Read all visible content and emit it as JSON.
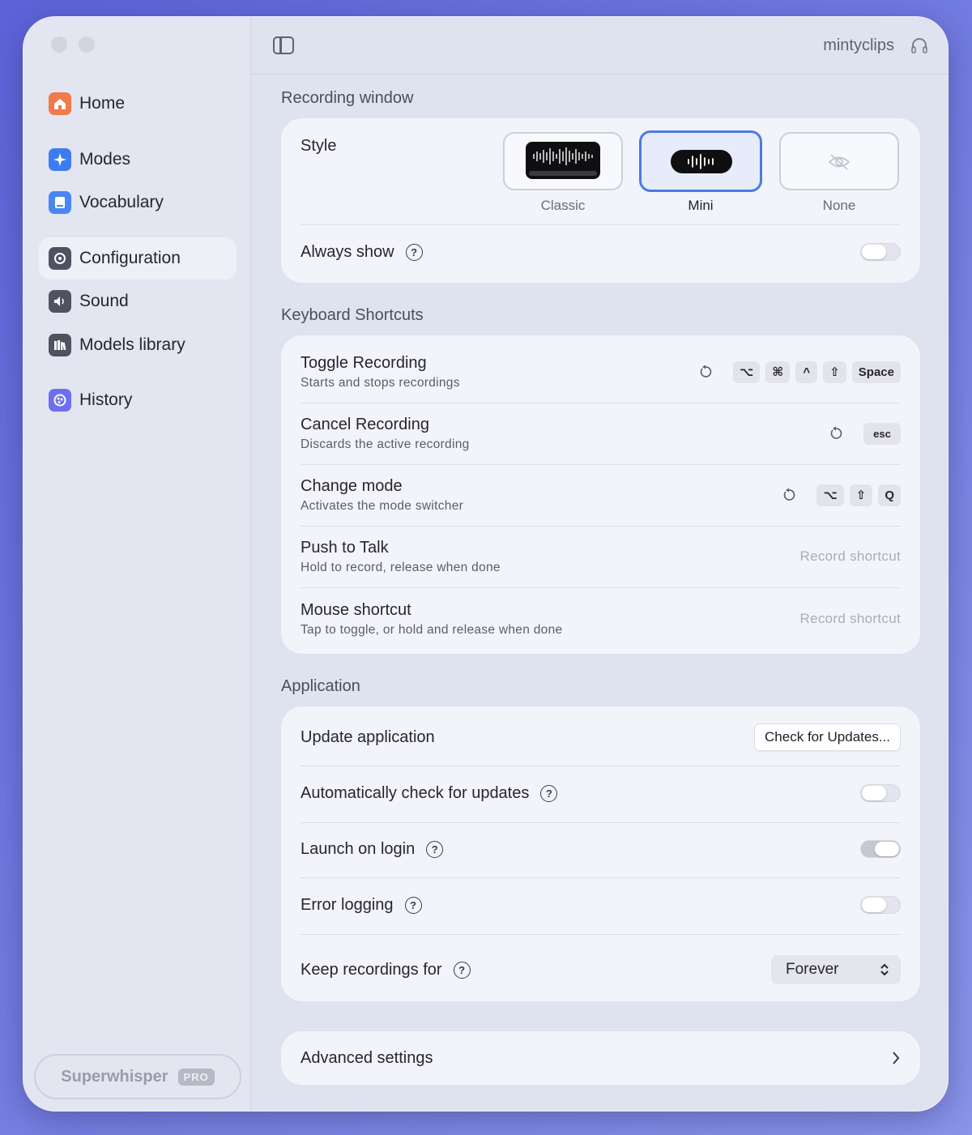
{
  "sidebar": {
    "items": [
      {
        "label": "Home",
        "icon": "home-icon",
        "color": "#f07a4a"
      },
      {
        "label": "Modes",
        "icon": "sparkle-icon",
        "color": "#3d7cf0"
      },
      {
        "label": "Vocabulary",
        "icon": "book-icon",
        "color": "#4a86ef"
      },
      {
        "label": "Configuration",
        "icon": "gear-icon",
        "color": "#4f5260"
      },
      {
        "label": "Sound",
        "icon": "speaker-icon",
        "color": "#4f5260"
      },
      {
        "label": "Models library",
        "icon": "library-icon",
        "color": "#4f5260"
      },
      {
        "label": "History",
        "icon": "history-icon",
        "color": "#6d6ff0"
      }
    ],
    "active": "Configuration",
    "footer": {
      "label": "Superwhisper",
      "badge": "PRO"
    }
  },
  "header": {
    "user": "mintyclips"
  },
  "recording_window": {
    "title": "Recording window",
    "style_label": "Style",
    "options": [
      "Classic",
      "Mini",
      "None"
    ],
    "selected": "Mini",
    "always_show": {
      "label": "Always show",
      "on": false
    }
  },
  "shortcuts": {
    "title": "Keyboard Shortcuts",
    "items": [
      {
        "title": "Toggle Recording",
        "subtitle": "Starts and stops recordings",
        "keys": [
          "⌥",
          "⌘",
          "^",
          "⇧",
          "Space"
        ]
      },
      {
        "title": "Cancel Recording",
        "subtitle": "Discards the active recording",
        "keys": [
          "esc"
        ]
      },
      {
        "title": "Change mode",
        "subtitle": "Activates the mode switcher",
        "keys": [
          "⌥",
          "⇧",
          "Q"
        ]
      },
      {
        "title": "Push to Talk",
        "subtitle": "Hold to record, release when done",
        "placeholder": "Record shortcut"
      },
      {
        "title": "Mouse shortcut",
        "subtitle": "Tap to toggle, or hold and release when done",
        "placeholder": "Record shortcut"
      }
    ]
  },
  "application": {
    "title": "Application",
    "update": {
      "label": "Update application",
      "button": "Check for Updates..."
    },
    "auto_check": {
      "label": "Automatically check for updates",
      "on": false
    },
    "launch_login": {
      "label": "Launch on login",
      "on": true
    },
    "error_logging": {
      "label": "Error logging",
      "on": false
    },
    "keep": {
      "label": "Keep recordings for",
      "value": "Forever"
    }
  },
  "advanced": {
    "label": "Advanced settings"
  }
}
